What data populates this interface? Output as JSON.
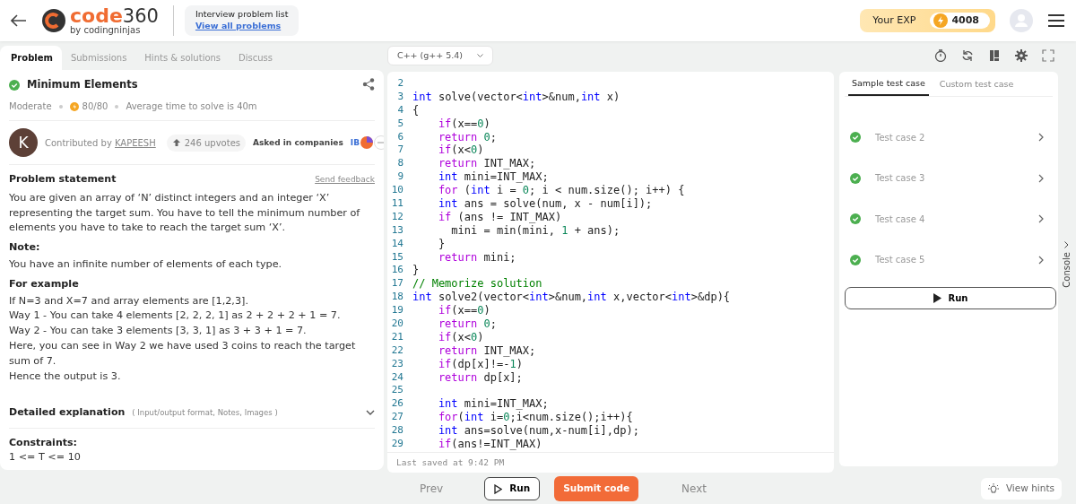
{
  "header": {
    "logo_word": "code",
    "logo_number": "360",
    "logo_sub": "by codingninjas",
    "list_title": "Interview problem list",
    "list_link": "View all problems",
    "exp_label": "Your EXP",
    "exp_value": "4008"
  },
  "problem_tabs": [
    {
      "label": "Problem",
      "selected": true
    },
    {
      "label": "Submissions",
      "selected": false
    },
    {
      "label": "Hints & solutions",
      "selected": false
    },
    {
      "label": "Discuss",
      "selected": false
    }
  ],
  "problem": {
    "solved": true,
    "title": "Minimum Elements",
    "difficulty": "Moderate",
    "score": "80/80",
    "avg_time": "Average time to solve is 40m",
    "avatar_letter": "K",
    "contributed_label": "Contributed by",
    "contributor": "KAPEESH",
    "upvotes": "246 upvotes",
    "companies_label": "Asked in companies",
    "company_text": "IB",
    "statement_title": "Problem statement",
    "feedback": "Send feedback",
    "paragraphs": [
      {
        "kind": "text",
        "text": "You are given an array of ‘N’ distinct integers and an integer ‘X’ representing the target sum. You have to tell the minimum number of elements you have to take to reach the target sum ‘X’."
      },
      {
        "kind": "heading",
        "text": "Note:"
      },
      {
        "kind": "text",
        "text": "You have an infinite number of elements of each type."
      },
      {
        "kind": "heading",
        "text": "For example"
      },
      {
        "kind": "text",
        "text": "If N=3 and X=7 and array elements are [1,2,3]."
      },
      {
        "kind": "text",
        "text": "Way 1 - You can take 4 elements  [2, 2, 2, 1] as 2 + 2 + 2 + 1 = 7."
      },
      {
        "kind": "text",
        "text": "Way 2 - You can take 3 elements  [3, 3, 1] as 3 + 3 + 1 = 7."
      },
      {
        "kind": "text",
        "text": "Here, you can see in Way 2 we have used 3 coins to reach the target sum of 7."
      },
      {
        "kind": "text",
        "text": "Hence the output is 3."
      }
    ],
    "explanation_title": "Detailed explanation",
    "explanation_hint": "( Input/output format, Notes, Images )",
    "constraints_title": "Constraints:",
    "constraint": "1 <= T <= 10"
  },
  "editor": {
    "language": "C++ (g++ 5.4)",
    "last_saved": "Last saved at 9:42 PM",
    "lines": [
      {
        "n": "2"
      },
      {
        "n": "3",
        "tokens": [
          {
            "kind": "type",
            "text": "int"
          },
          {
            "kind": "plain",
            "text": " solve(vector<"
          },
          {
            "kind": "type",
            "text": "int"
          },
          {
            "kind": "plain",
            "text": ">&num,"
          },
          {
            "kind": "type",
            "text": "int"
          },
          {
            "kind": "plain",
            "text": " x)"
          }
        ]
      },
      {
        "n": "4",
        "tokens": [
          {
            "kind": "plain",
            "text": "{"
          }
        ]
      },
      {
        "n": "5",
        "tokens": [
          {
            "kind": "control",
            "text": "    if"
          },
          {
            "kind": "plain",
            "text": "(x=="
          },
          {
            "kind": "number",
            "text": "0"
          },
          {
            "kind": "plain",
            "text": ")"
          }
        ]
      },
      {
        "n": "6",
        "tokens": [
          {
            "kind": "control",
            "text": "    return"
          },
          {
            "kind": "number",
            "text": " 0"
          },
          {
            "kind": "plain",
            "text": ";"
          }
        ]
      },
      {
        "n": "7",
        "tokens": [
          {
            "kind": "control",
            "text": "    if"
          },
          {
            "kind": "plain",
            "text": "(x<"
          },
          {
            "kind": "number",
            "text": "0"
          },
          {
            "kind": "plain",
            "text": ")"
          }
        ]
      },
      {
        "n": "8",
        "tokens": [
          {
            "kind": "control",
            "text": "    return"
          },
          {
            "kind": "plain",
            "text": " INT_MAX;"
          }
        ]
      },
      {
        "n": "9",
        "tokens": [
          {
            "kind": "type",
            "text": "    int"
          },
          {
            "kind": "plain",
            "text": " mini=INT_MAX;"
          }
        ]
      },
      {
        "n": "10",
        "tokens": [
          {
            "kind": "control",
            "text": "    for"
          },
          {
            "kind": "plain",
            "text": " ("
          },
          {
            "kind": "type",
            "text": "int"
          },
          {
            "kind": "plain",
            "text": " i = "
          },
          {
            "kind": "number",
            "text": "0"
          },
          {
            "kind": "plain",
            "text": "; i < num.size(); i++) {"
          }
        ]
      },
      {
        "n": "11",
        "tokens": [
          {
            "kind": "type",
            "text": "    int"
          },
          {
            "kind": "plain",
            "text": " ans = solve(num, x - num[i]);"
          }
        ]
      },
      {
        "n": "12",
        "tokens": [
          {
            "kind": "control",
            "text": "    if"
          },
          {
            "kind": "plain",
            "text": " (ans != INT_MAX)"
          }
        ]
      },
      {
        "n": "13",
        "tokens": [
          {
            "kind": "plain",
            "text": "      mini = min(mini, "
          },
          {
            "kind": "number",
            "text": "1"
          },
          {
            "kind": "plain",
            "text": " + ans);"
          }
        ]
      },
      {
        "n": "14",
        "tokens": [
          {
            "kind": "plain",
            "text": "    }"
          }
        ]
      },
      {
        "n": "15",
        "tokens": [
          {
            "kind": "control",
            "text": "    return"
          },
          {
            "kind": "plain",
            "text": " mini;"
          }
        ]
      },
      {
        "n": "16",
        "tokens": [
          {
            "kind": "plain",
            "text": "}"
          }
        ]
      },
      {
        "n": "17",
        "tokens": [
          {
            "kind": "comment",
            "text": "// Memorize solution"
          }
        ]
      },
      {
        "n": "18",
        "tokens": [
          {
            "kind": "type",
            "text": "int"
          },
          {
            "kind": "plain",
            "text": " solve2(vector<"
          },
          {
            "kind": "type",
            "text": "int"
          },
          {
            "kind": "plain",
            "text": ">&num,"
          },
          {
            "kind": "type",
            "text": "int"
          },
          {
            "kind": "plain",
            "text": " x,vector<"
          },
          {
            "kind": "type",
            "text": "int"
          },
          {
            "kind": "plain",
            "text": ">&dp){"
          }
        ]
      },
      {
        "n": "19",
        "tokens": [
          {
            "kind": "control",
            "text": "    if"
          },
          {
            "kind": "plain",
            "text": "(x=="
          },
          {
            "kind": "number",
            "text": "0"
          },
          {
            "kind": "plain",
            "text": ")"
          }
        ]
      },
      {
        "n": "20",
        "tokens": [
          {
            "kind": "control",
            "text": "    return"
          },
          {
            "kind": "number",
            "text": " 0"
          },
          {
            "kind": "plain",
            "text": ";"
          }
        ]
      },
      {
        "n": "21",
        "tokens": [
          {
            "kind": "control",
            "text": "    if"
          },
          {
            "kind": "plain",
            "text": "(x<"
          },
          {
            "kind": "number",
            "text": "0"
          },
          {
            "kind": "plain",
            "text": ")"
          }
        ]
      },
      {
        "n": "22",
        "tokens": [
          {
            "kind": "control",
            "text": "    return"
          },
          {
            "kind": "plain",
            "text": " INT_MAX;"
          }
        ]
      },
      {
        "n": "23",
        "tokens": [
          {
            "kind": "control",
            "text": "    if"
          },
          {
            "kind": "plain",
            "text": "(dp[x]!=-"
          },
          {
            "kind": "number",
            "text": "1"
          },
          {
            "kind": "plain",
            "text": ")"
          }
        ]
      },
      {
        "n": "24",
        "tokens": [
          {
            "kind": "control",
            "text": "    return"
          },
          {
            "kind": "plain",
            "text": " dp[x];"
          }
        ]
      },
      {
        "n": "25"
      },
      {
        "n": "26",
        "tokens": [
          {
            "kind": "type",
            "text": "    int"
          },
          {
            "kind": "plain",
            "text": " mini=INT_MAX;"
          }
        ]
      },
      {
        "n": "27",
        "tokens": [
          {
            "kind": "control",
            "text": "    for"
          },
          {
            "kind": "plain",
            "text": "("
          },
          {
            "kind": "type",
            "text": "int"
          },
          {
            "kind": "plain",
            "text": " i="
          },
          {
            "kind": "number",
            "text": "0"
          },
          {
            "kind": "plain",
            "text": ";i<num.size();i++){"
          }
        ]
      },
      {
        "n": "28",
        "tokens": [
          {
            "kind": "type",
            "text": "    int"
          },
          {
            "kind": "plain",
            "text": " ans=solve(num,x-num[i],dp);"
          }
        ]
      },
      {
        "n": "29",
        "tokens": [
          {
            "kind": "control",
            "text": "    if"
          },
          {
            "kind": "plain",
            "text": "(ans!=INT_MAX)"
          }
        ]
      }
    ]
  },
  "test_tabs": [
    {
      "label": "Sample test case",
      "selected": true
    },
    {
      "label": "Custom test case",
      "selected": false
    }
  ],
  "test_cases": [
    {
      "label": "Test case 2",
      "passed": true
    },
    {
      "label": "Test case 3",
      "passed": true
    },
    {
      "label": "Test case 4",
      "passed": true
    },
    {
      "label": "Test case 5",
      "passed": true
    }
  ],
  "test_run": "Run",
  "console": "Console",
  "footer": {
    "prev": "Prev",
    "run": "Run",
    "submit": "Submit code",
    "next": "Next",
    "hints": "View hints"
  }
}
